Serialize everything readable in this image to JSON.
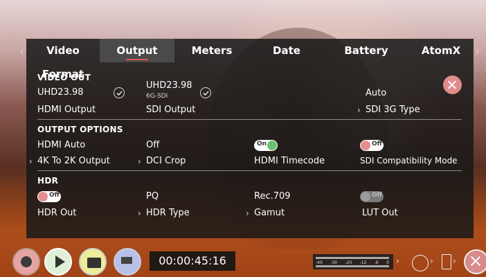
{
  "tabs": [
    "Video Format",
    "Output",
    "Meters",
    "Date",
    "Battery",
    "AtomX"
  ],
  "active_tab": "Output",
  "video_out": {
    "heading": "VIDEO OUT",
    "hdmi_value": "UHD23.98",
    "hdmi_label": "HDMI Output",
    "sdi_value": "UHD23.98",
    "sdi_sub": "6G-SDI",
    "sdi_label": "SDI Output",
    "sdi_type_value": "Auto",
    "sdi_type_label": "SDI 3G Type"
  },
  "output_options": {
    "heading": "OUTPUT OPTIONS",
    "hdmi_auto_value": "HDMI Auto",
    "hdmi_auto_label": "4K To 2K Output",
    "dci_value": "Off",
    "dci_label": "DCI Crop",
    "timecode_toggle": "On",
    "timecode_label": "HDMI Timecode",
    "sdi_compat_toggle": "Off",
    "sdi_compat_label": "SDI Compatibility Mode"
  },
  "hdr": {
    "heading": "HDR",
    "hdr_out_toggle": "Off",
    "hdr_out_label": "HDR Out",
    "hdr_type_value": "PQ",
    "hdr_type_label": "HDR Type",
    "gamut_value": "Rec.709",
    "gamut_label": "Gamut",
    "lut_toggle": "Off",
    "lut_label": "LUT Out"
  },
  "bottom": {
    "timecode": "00:00:45:16",
    "meter_scale": [
      "-40",
      "-30",
      "-20",
      "-12",
      "-6",
      "0"
    ]
  },
  "colors": {
    "accent": "#e05a5a",
    "toggle_on": "#6fbf6f",
    "toggle_off": "#e38f8f"
  }
}
